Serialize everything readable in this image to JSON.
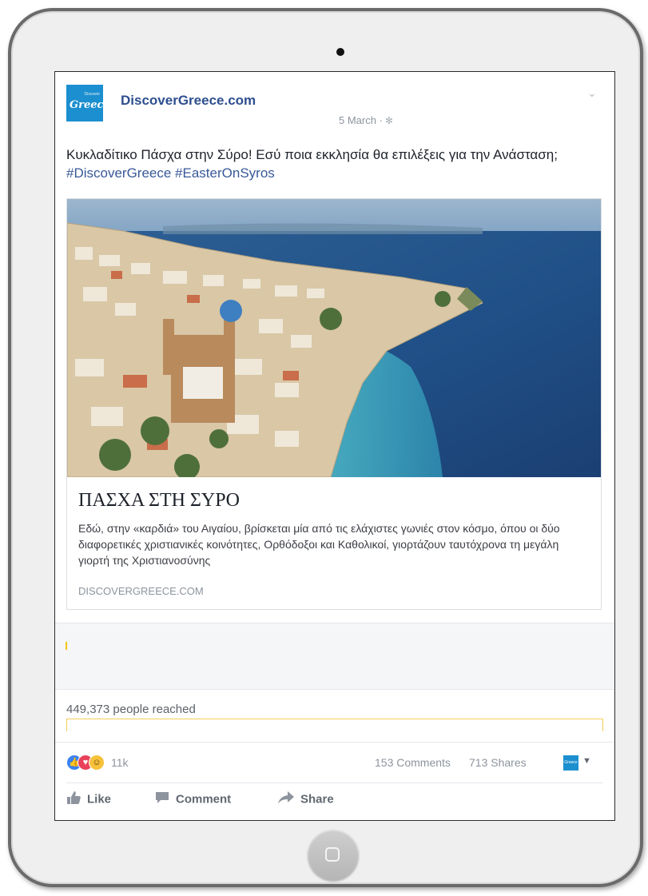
{
  "post": {
    "page_name": "DiscoverGreece.com",
    "logo_text": "Greece",
    "logo_small_text": "Discover",
    "date": "5 March ·",
    "text": "Κυκλαδίτικο Πάσχα στην Σύρο! Εσύ ποια εκκλησία θα επιλέξεις για την Ανάσταση;",
    "hashtags": "#DiscoverGreece #EasterOnSyros"
  },
  "link_preview": {
    "title": "ΠΑΣΧΑ ΣΤΗ ΣΥΡΟ",
    "description": "Εδώ, στην «καρδιά» του Αιγαίου, βρίσκεται μία από τις ελάχιστες γωνιές στον κόσμο, όπου οι δύο διαφορετικές χριστιανικές κοινότητες, Ορθόδοξοι και Καθολικοί, γιορτάζουν ταυτόχρονα τη μεγάλη γιορτή της Χριστιανοσύνης",
    "domain": "DISCOVERGREECE.COM"
  },
  "insights": {
    "reach_text": "449,373 people reached"
  },
  "engagement": {
    "reactions_count": "11k",
    "comments": "153 Comments",
    "shares": "713 Shares",
    "reaction_icons": [
      "like-icon",
      "love-icon",
      "wow-icon"
    ]
  },
  "actions": {
    "like": "Like",
    "comment": "Comment",
    "share": "Share"
  },
  "colors": {
    "brand_blue": "#1b8fcf",
    "link_blue": "#385898",
    "reach_bar": "#f4cf5a"
  }
}
